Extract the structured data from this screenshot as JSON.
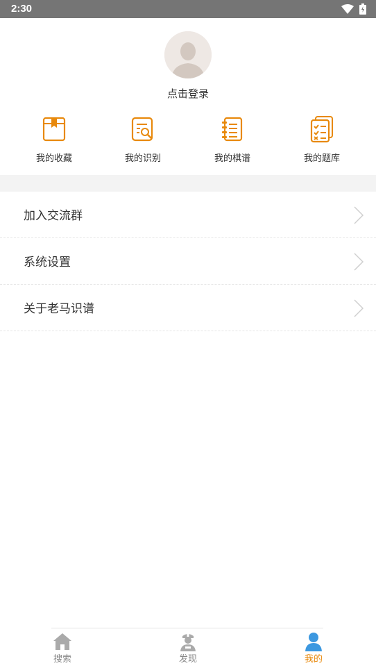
{
  "status_bar": {
    "time": "2:30"
  },
  "profile": {
    "login_label": "点击登录"
  },
  "quick_actions": [
    {
      "label": "我的收藏",
      "icon": "bookmark-icon"
    },
    {
      "label": "我的识别",
      "icon": "recognition-search-icon"
    },
    {
      "label": "我的棋谱",
      "icon": "notebook-icon"
    },
    {
      "label": "我的题库",
      "icon": "checklist-icon"
    }
  ],
  "menu": [
    {
      "label": "加入交流群"
    },
    {
      "label": "系统设置"
    },
    {
      "label": "关于老马识谱"
    }
  ],
  "tabbar": {
    "tabs": [
      {
        "label": "搜索",
        "icon": "home-icon",
        "active": false
      },
      {
        "label": "发现",
        "icon": "doctor-icon",
        "active": false
      },
      {
        "label": "我的",
        "icon": "person-icon",
        "active": true
      }
    ]
  },
  "colors": {
    "accent_orange": "#e8890c",
    "active_blue": "#3c98e0",
    "active_label": "#e8890c",
    "inactive_icon": "#aaaaaa",
    "status_bar": "#757575"
  }
}
